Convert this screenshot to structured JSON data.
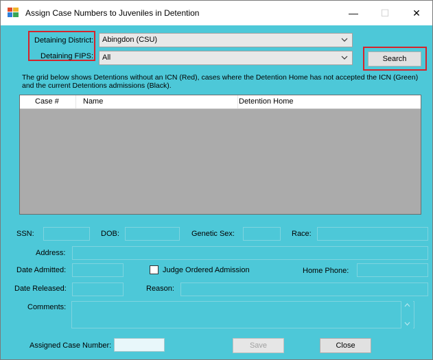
{
  "window": {
    "title": "Assign Case Numbers to Juveniles in Detention",
    "minimize_glyph": "—",
    "maximize_glyph": "☐",
    "close_glyph": "✕"
  },
  "filters": {
    "district_label": "Detaining District:",
    "district_value": "Abingdon (CSU)",
    "fips_label": "Detaining FIPS:",
    "fips_value": "All",
    "search_label": "Search"
  },
  "description": "The grid below shows Detentions without an ICN (Red), cases where the Detention Home has not accepted the ICN (Green) and the current Detentions admissions (Black).",
  "grid": {
    "columns": [
      "Case #",
      "Name",
      "Detention Home"
    ]
  },
  "details": {
    "ssn_label": "SSN:",
    "dob_label": "DOB:",
    "genetic_sex_label": "Genetic Sex:",
    "race_label": "Race:",
    "address_label": "Address:",
    "date_admitted_label": "Date Admitted:",
    "judge_ordered_label": "Judge Ordered Admission",
    "home_phone_label": "Home Phone:",
    "date_released_label": "Date Released:",
    "reason_label": "Reason:",
    "comments_label": "Comments:",
    "assigned_case_label": "Assigned Case Number:"
  },
  "actions": {
    "save_label": "Save",
    "close_label": "Close"
  },
  "colors": {
    "form_background": "#4dc8d8",
    "grid_background": "#ababab",
    "highlight": "#d6222a"
  }
}
